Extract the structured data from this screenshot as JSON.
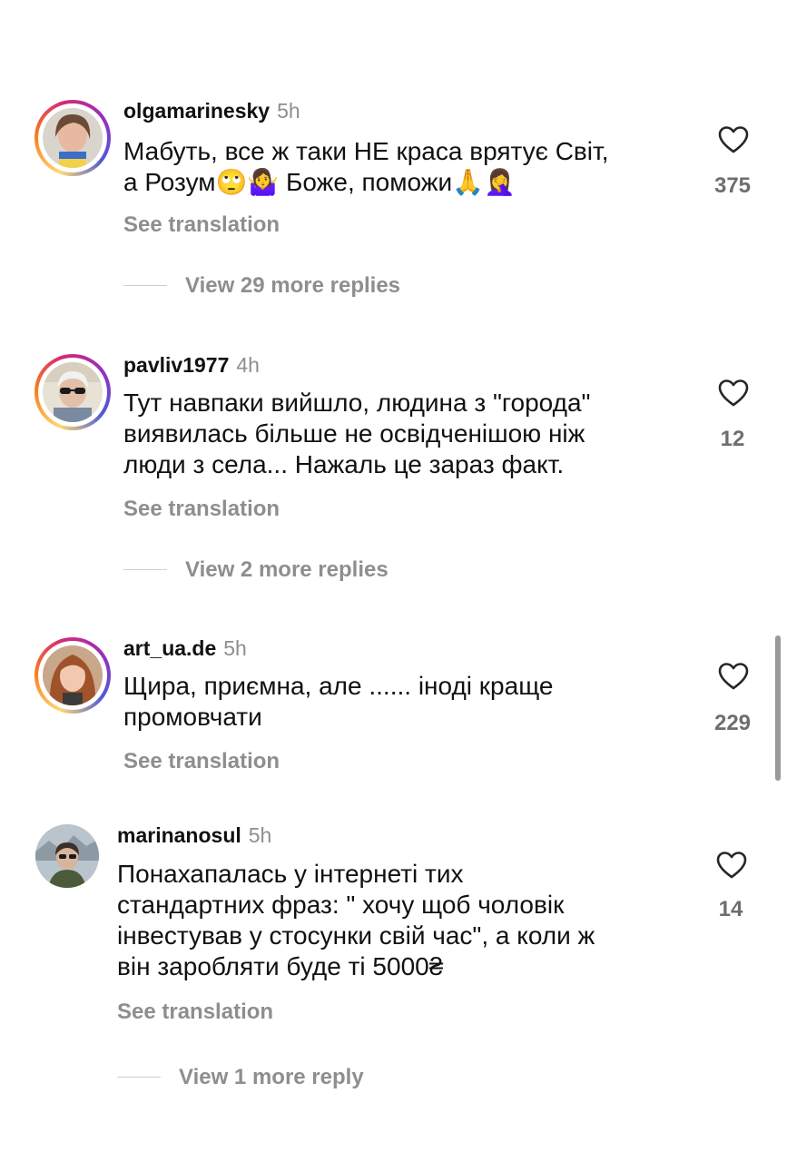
{
  "comments": [
    {
      "username": "olgamarinesky",
      "time": "5h",
      "text_lines": [
        "Мабуть, все ж таки НЕ краса врятує Світ,",
        "а Розум🙄🤷‍♀️ Боже, поможи🙏🤦‍♀️"
      ],
      "see_translation": "See translation",
      "replies_label": "View 29 more replies",
      "likes": "375",
      "has_story_ring": true
    },
    {
      "username": "pavliv1977",
      "time": "4h",
      "text_lines": [
        "Тут навпаки вийшло, людина з \"города\"",
        "виявилась більше не освідченішою ніж",
        "люди з села... Нажаль це зараз факт."
      ],
      "see_translation": "See translation",
      "replies_label": "View 2 more replies",
      "likes": "12",
      "has_story_ring": true
    },
    {
      "username": "art_ua.de",
      "time": "5h",
      "text_lines": [
        "Щира, приємна, але ...... іноді краще",
        "промовчати"
      ],
      "see_translation": "See translation",
      "likes": "229",
      "has_story_ring": true
    },
    {
      "username": "marinanosul",
      "time": "5h",
      "text_lines": [
        "Понахапалась у інтернеті тих",
        "стандартних фраз: \" хочу щоб чоловік",
        "інвестував у стосунки свій час\", а коли ж",
        "він заробляти буде ті 5000₴"
      ],
      "see_translation": "See translation",
      "replies_label": "View 1 more reply",
      "likes": "14",
      "has_story_ring": false
    }
  ],
  "icons": {
    "like": "heart-outline-icon"
  },
  "colors": {
    "secondary_text": "#8e8e8e",
    "primary_text": "#111111"
  }
}
